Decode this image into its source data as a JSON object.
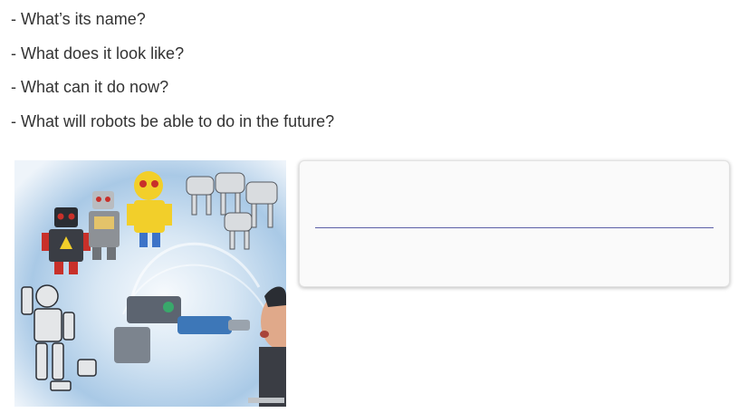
{
  "questions": [
    "- What’s its name?",
    "- What does it look like?",
    "- What can it do now?",
    "- What will robots be able to do in the future?"
  ],
  "illustration": {
    "subject": "robots-collage",
    "colors": {
      "sky_light": "#eef4fa",
      "sky_blue": "#9cc0e0",
      "robot_red": "#c8302a",
      "robot_yellow": "#f2cf2a",
      "robot_grey": "#8d9196",
      "dark": "#2a2d33"
    }
  },
  "answer": {
    "value": "",
    "line_color": "#5b5fa6"
  }
}
